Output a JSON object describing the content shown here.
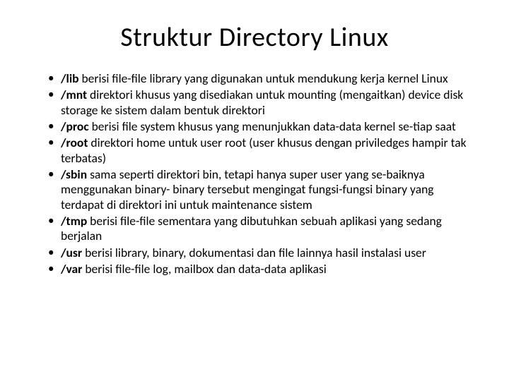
{
  "title": "Struktur Directory Linux",
  "items": [
    {
      "term": "/lib",
      "desc": " berisi file-file library yang digunakan untuk mendukung kerja kernel Linux"
    },
    {
      "term": "/mnt",
      "desc": " direktori khusus yang disediakan untuk mounting (mengaitkan) device disk storage ke sistem dalam bentuk direktori"
    },
    {
      "term": "/proc",
      "desc": " berisi file system khusus yang menunjukkan data-data kernel se-tiap saat"
    },
    {
      "term": "/root",
      "desc": " direktori home untuk user root (user khusus dengan priviledges hampir tak terbatas)"
    },
    {
      "term": "/sbin",
      "desc": " sama seperti direktori bin, tetapi hanya super user yang se-baiknya menggunakan binary- binary tersebut mengingat fungsi-fungsi binary yang terdapat di direktori ini untuk maintenance sistem"
    },
    {
      "term": "/tmp",
      "desc": " berisi file-file sementara yang dibutuhkan sebuah aplikasi yang sedang berjalan"
    },
    {
      "term": "/usr",
      "desc": " berisi library, binary, dokumentasi dan file lainnya hasil instalasi user"
    },
    {
      "term": "/var",
      "desc": " berisi file-file log, mailbox dan data-data aplikasi"
    }
  ]
}
